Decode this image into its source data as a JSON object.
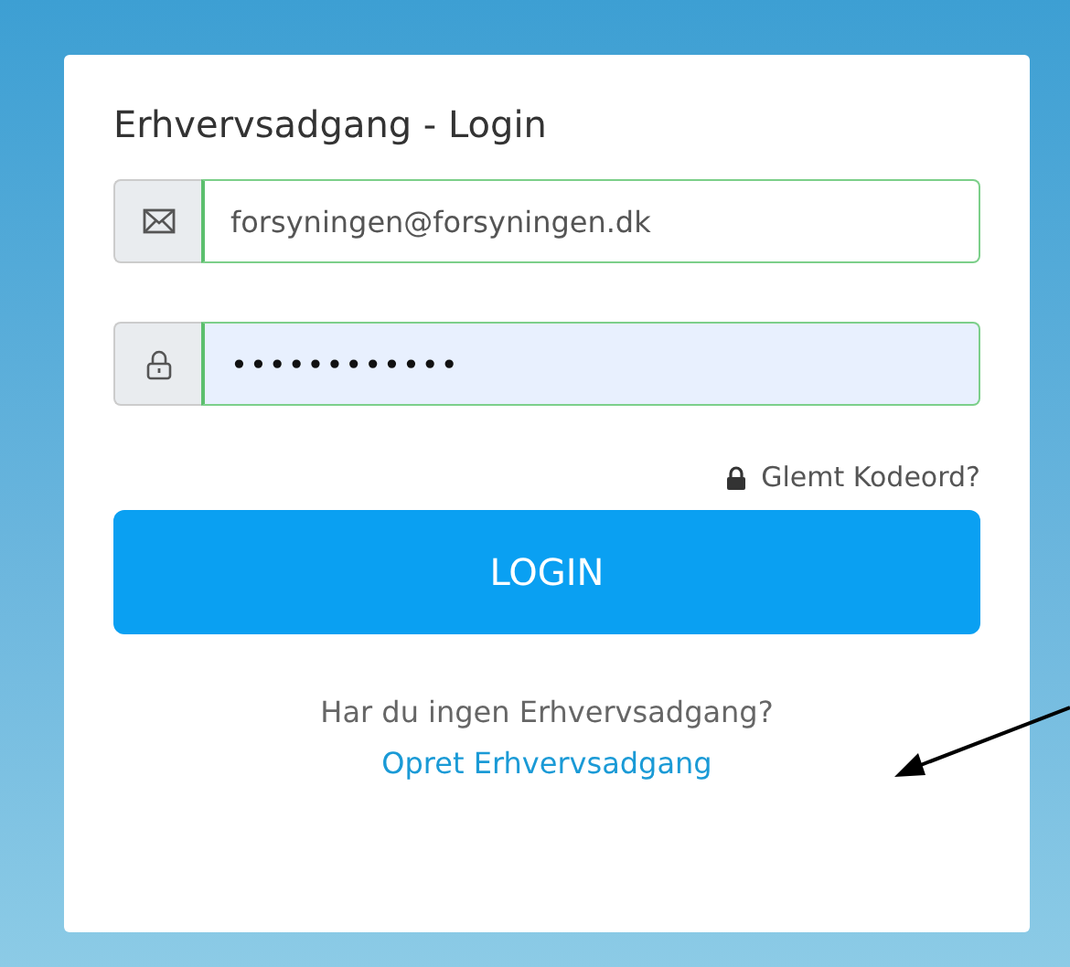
{
  "title": "Erhvervsadgang - Login",
  "fields": [
    {
      "kind": "email",
      "value": "forsyningen@forsyningen.dk"
    },
    {
      "kind": "password",
      "value": "••••••••••••"
    }
  ],
  "forgot_link": "Glemt Kodeord?",
  "login_button": "LOGIN",
  "signup": {
    "prompt": "Har du ingen Erhvervsadgang?",
    "link": "Opret Erhvervsadgang"
  }
}
